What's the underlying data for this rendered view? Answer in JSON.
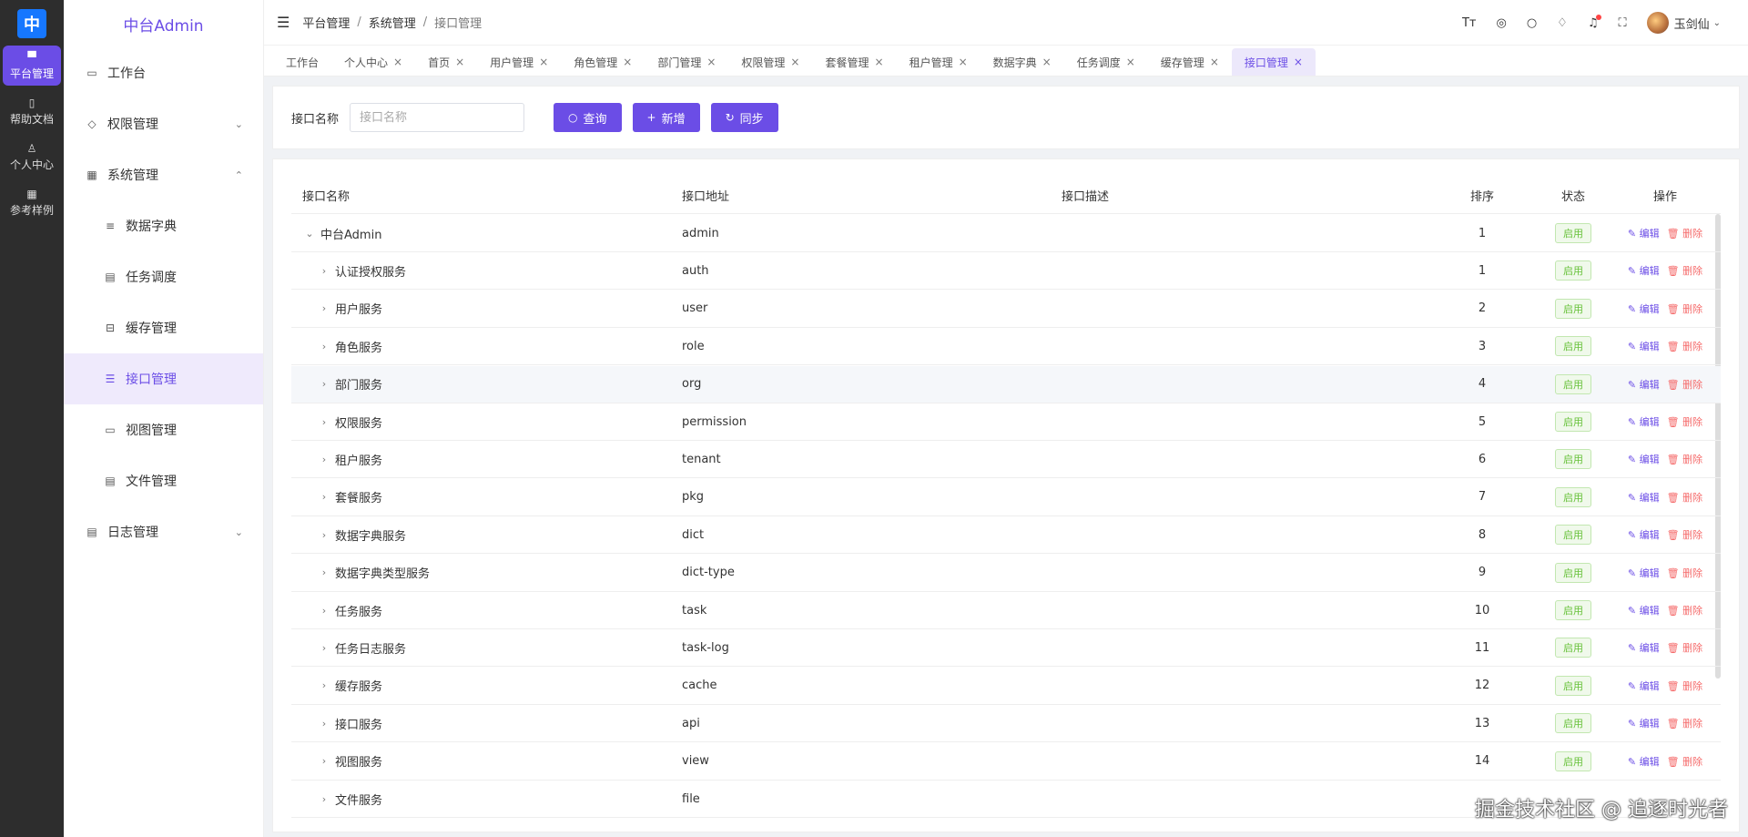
{
  "rail": {
    "logo": "中",
    "items": [
      {
        "icon": "monitor-icon",
        "glyph": "▀",
        "label": "平台管理",
        "active": true
      },
      {
        "icon": "book-icon",
        "glyph": "▯",
        "label": "帮助文档",
        "active": false
      },
      {
        "icon": "user-icon",
        "glyph": "♙",
        "label": "个人中心",
        "active": false
      },
      {
        "icon": "grid-icon",
        "glyph": "▦",
        "label": "参考样例",
        "active": false
      }
    ]
  },
  "sidebar": {
    "title": "中台Admin",
    "items": [
      {
        "label": "工作台",
        "icon": "dashboard-icon",
        "glyph": "▭",
        "level": 1,
        "chevron": ""
      },
      {
        "label": "权限管理",
        "icon": "shield-icon",
        "glyph": "◇",
        "level": 1,
        "chevron": "⌄"
      },
      {
        "label": "系统管理",
        "icon": "windows-icon",
        "glyph": "▦",
        "level": 1,
        "chevron": "⌃"
      },
      {
        "label": "数据字典",
        "icon": "database-icon",
        "glyph": "≡",
        "level": 2,
        "chevron": ""
      },
      {
        "label": "任务调度",
        "icon": "server-icon",
        "glyph": "▤",
        "level": 2,
        "chevron": ""
      },
      {
        "label": "缓存管理",
        "icon": "cache-icon",
        "glyph": "⊟",
        "level": 2,
        "chevron": ""
      },
      {
        "label": "接口管理",
        "icon": "sliders-icon",
        "glyph": "☰",
        "level": 2,
        "chevron": "",
        "active": true
      },
      {
        "label": "视图管理",
        "icon": "card-icon",
        "glyph": "▭",
        "level": 2,
        "chevron": ""
      },
      {
        "label": "文件管理",
        "icon": "file-icon",
        "glyph": "▤",
        "level": 2,
        "chevron": ""
      },
      {
        "label": "日志管理",
        "icon": "log-icon",
        "glyph": "▤",
        "level": 1,
        "chevron": "⌄"
      }
    ]
  },
  "header": {
    "breadcrumb": [
      "平台管理",
      "系统管理",
      "接口管理"
    ],
    "user_name": "玉剑仙"
  },
  "tabs": [
    {
      "label": "工作台",
      "closable": false
    },
    {
      "label": "个人中心",
      "closable": true
    },
    {
      "label": "首页",
      "closable": true
    },
    {
      "label": "用户管理",
      "closable": true
    },
    {
      "label": "角色管理",
      "closable": true
    },
    {
      "label": "部门管理",
      "closable": true
    },
    {
      "label": "权限管理",
      "closable": true
    },
    {
      "label": "套餐管理",
      "closable": true
    },
    {
      "label": "租户管理",
      "closable": true
    },
    {
      "label": "数据字典",
      "closable": true
    },
    {
      "label": "任务调度",
      "closable": true
    },
    {
      "label": "缓存管理",
      "closable": true
    },
    {
      "label": "接口管理",
      "closable": true,
      "active": true
    }
  ],
  "search": {
    "label": "接口名称",
    "placeholder": "接口名称",
    "value": "",
    "query_label": "查询",
    "add_label": "新增",
    "sync_label": "同步"
  },
  "table": {
    "columns": {
      "name": "接口名称",
      "path": "接口地址",
      "desc": "接口描述",
      "order": "排序",
      "state": "状态",
      "op": "操作"
    },
    "edit_label": "编辑",
    "delete_label": "删除",
    "rows": [
      {
        "name": "中台Admin",
        "path": "admin",
        "desc": "",
        "order": "1",
        "state": "启用",
        "expanded": true,
        "child": false
      },
      {
        "name": "认证授权服务",
        "path": "auth",
        "desc": "",
        "order": "1",
        "state": "启用",
        "expanded": false,
        "child": true
      },
      {
        "name": "用户服务",
        "path": "user",
        "desc": "",
        "order": "2",
        "state": "启用",
        "expanded": false,
        "child": true
      },
      {
        "name": "角色服务",
        "path": "role",
        "desc": "",
        "order": "3",
        "state": "启用",
        "expanded": false,
        "child": true
      },
      {
        "name": "部门服务",
        "path": "org",
        "desc": "",
        "order": "4",
        "state": "启用",
        "expanded": false,
        "child": true,
        "hover": true
      },
      {
        "name": "权限服务",
        "path": "permission",
        "desc": "",
        "order": "5",
        "state": "启用",
        "expanded": false,
        "child": true
      },
      {
        "name": "租户服务",
        "path": "tenant",
        "desc": "",
        "order": "6",
        "state": "启用",
        "expanded": false,
        "child": true
      },
      {
        "name": "套餐服务",
        "path": "pkg",
        "desc": "",
        "order": "7",
        "state": "启用",
        "expanded": false,
        "child": true
      },
      {
        "name": "数据字典服务",
        "path": "dict",
        "desc": "",
        "order": "8",
        "state": "启用",
        "expanded": false,
        "child": true
      },
      {
        "name": "数据字典类型服务",
        "path": "dict-type",
        "desc": "",
        "order": "9",
        "state": "启用",
        "expanded": false,
        "child": true
      },
      {
        "name": "任务服务",
        "path": "task",
        "desc": "",
        "order": "10",
        "state": "启用",
        "expanded": false,
        "child": true
      },
      {
        "name": "任务日志服务",
        "path": "task-log",
        "desc": "",
        "order": "11",
        "state": "启用",
        "expanded": false,
        "child": true
      },
      {
        "name": "缓存服务",
        "path": "cache",
        "desc": "",
        "order": "12",
        "state": "启用",
        "expanded": false,
        "child": true
      },
      {
        "name": "接口服务",
        "path": "api",
        "desc": "",
        "order": "13",
        "state": "启用",
        "expanded": false,
        "child": true
      },
      {
        "name": "视图服务",
        "path": "view",
        "desc": "",
        "order": "14",
        "state": "启用",
        "expanded": false,
        "child": true
      },
      {
        "name": "文件服务",
        "path": "file",
        "desc": "",
        "order": "",
        "state": "",
        "expanded": false,
        "child": true
      }
    ]
  },
  "watermark": "掘金技术社区 @ 追逐时光者",
  "colors": {
    "accent": "#6b4de6",
    "success": "#67c23a",
    "danger": "#f56c6c"
  }
}
